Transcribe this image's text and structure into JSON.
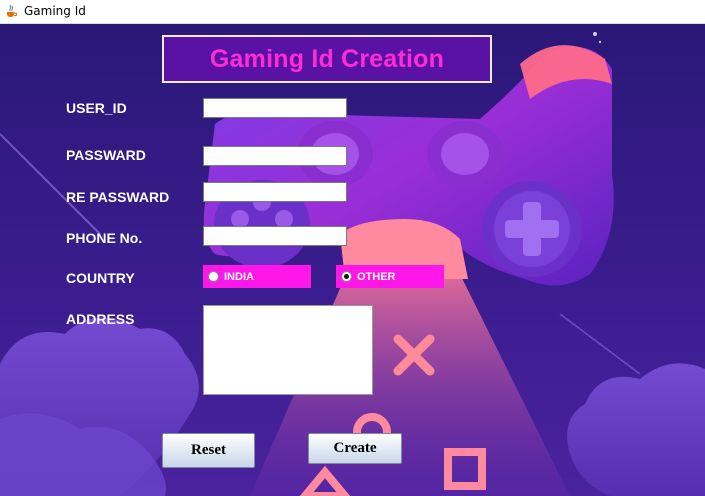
{
  "window": {
    "title": "Gaming Id",
    "icon": "java-cup-icon"
  },
  "heading": "Gaming Id Creation",
  "colors": {
    "heading_text": "#ff2bd6",
    "radio_bg": "#ff16e8",
    "background": "#3a1a87"
  },
  "form": {
    "user_id": {
      "label": "USER_ID",
      "value": ""
    },
    "password": {
      "label": "PASSWARD",
      "value": ""
    },
    "re_password": {
      "label": "RE PASSWARD",
      "value": ""
    },
    "phone": {
      "label": "PHONE No.",
      "value": ""
    },
    "country": {
      "label": "COUNTRY",
      "options": [
        "INDIA",
        "OTHER"
      ],
      "selected": "OTHER"
    },
    "address": {
      "label": "ADDRESS",
      "value": ""
    }
  },
  "buttons": {
    "reset": "Reset",
    "create": "Create"
  },
  "background_icons": [
    "gamepad-illustration",
    "cross-symbol-icon",
    "circle-symbol-icon",
    "triangle-symbol-icon",
    "square-symbol-icon"
  ]
}
